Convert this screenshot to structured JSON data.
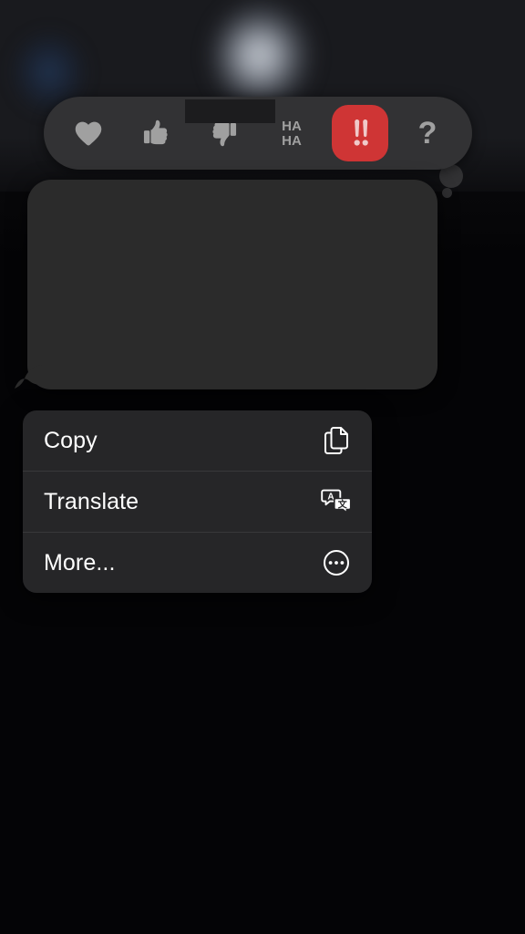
{
  "app": {
    "name": "Messages",
    "platform": "iOS",
    "screen_state": "message-long-press-tapback-and-context-menu",
    "appearance": "dark",
    "background_color": "#040406",
    "dimmed_overlay": true
  },
  "background": {
    "blurred_avatar": {
      "name": "blurred-contact-avatar",
      "description": "blurred light circular avatar at top center"
    },
    "blue_glow": {
      "name": "blurred-blue-glow",
      "description": "faint blue blurred shape at upper left"
    },
    "header_band_color": "#191a1e"
  },
  "tapback": {
    "name": "tapback-reaction-bar",
    "background_color": "#323234",
    "selected_color": "#cf3535",
    "glyph_color": "#a0a0a0",
    "selected_index": 4,
    "reactions": [
      {
        "id": "heart",
        "label": "Love",
        "icon": "heart-icon",
        "selected": false
      },
      {
        "id": "thumbs-up",
        "label": "Like",
        "icon": "thumbs-up-icon",
        "selected": false
      },
      {
        "id": "thumbs-down",
        "label": "Dislike",
        "icon": "thumbs-down-icon",
        "selected": false
      },
      {
        "id": "haha",
        "label": "Haha",
        "icon": "haha-icon",
        "selected": false,
        "text_top": "HA",
        "text_bottom": "HA"
      },
      {
        "id": "exclamation",
        "label": "Emphasize",
        "icon": "double-exclamation-icon",
        "selected": true
      },
      {
        "id": "question",
        "label": "Question",
        "icon": "question-mark-icon",
        "selected": false
      }
    ],
    "redaction_bar": {
      "name": "redaction-bar",
      "color": "#1c1c1e",
      "description": "dark rectangle obscuring part of the bar"
    }
  },
  "message": {
    "name": "message-bubble",
    "side": "incoming",
    "text": "",
    "redacted": true,
    "bubble_color": "#2b2b2b",
    "has_tail": true,
    "tail_side": "bottom-left"
  },
  "context_menu": {
    "name": "message-context-menu",
    "background_color": "#262628",
    "divider_color": "#38383a",
    "label_color": "#ffffff",
    "items": [
      {
        "label": "Copy",
        "icon": "copy-icon"
      },
      {
        "label": "Translate",
        "icon": "translate-icon"
      },
      {
        "label": "More...",
        "icon": "more-ellipsis-circle-icon"
      }
    ]
  }
}
